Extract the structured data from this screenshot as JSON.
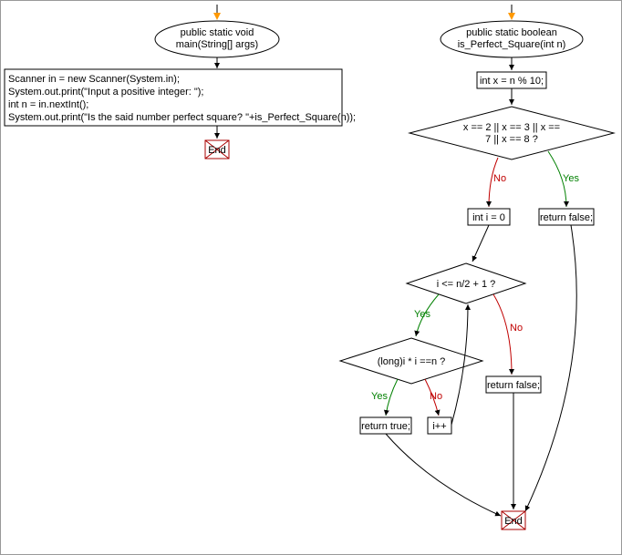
{
  "main": {
    "signature_line1": "public static void",
    "signature_line2": "main(String[] args)",
    "body_line1": "Scanner in = new Scanner(System.in);",
    "body_line2": "System.out.print(\"Input a positive integer: \");",
    "body_line3": "int n = in.nextInt();",
    "body_line4": "System.out.print(\"Is the said number perfect square? \"+is_Perfect_Square(n));",
    "end": "End"
  },
  "func": {
    "signature_line1": "public static boolean",
    "signature_line2": "is_Perfect_Square(int n)",
    "decl_x": "int x = n % 10;",
    "cond1_line1": "x == 2 || x == 3 || x ==",
    "cond1_line2": "7 || x == 8 ?",
    "return_false1": "return false;",
    "decl_i": "int i = 0",
    "cond2": "i <= n/2 + 1 ?",
    "cond3": "(long)i * i ==n ?",
    "return_true": "return true;",
    "inc": "i++",
    "return_false2": "return false;",
    "end": "End"
  },
  "labels": {
    "yes": "Yes",
    "no": "No"
  }
}
